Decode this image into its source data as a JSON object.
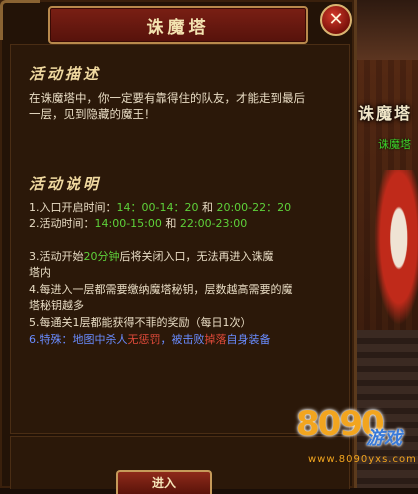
{
  "window": {
    "title": "诛魔塔",
    "close_label": "✕"
  },
  "section_description": {
    "title": "活动描述",
    "line1": "在诛魔塔中，你一定要有靠得住的队友，才能走到最后",
    "line2": "一层，见到隐藏的魔王！"
  },
  "section_rules": {
    "title": "活动说明",
    "rule1": {
      "prefix": "1.入口开启时间：",
      "time1": "14：00-14：20",
      "mid": " 和 ",
      "time2": "20:00-22：20"
    },
    "rule2": {
      "prefix": "2.活动时间：",
      "time1": "14:00-15:00",
      "mid": " 和 ",
      "time2": "22:00-23:00"
    },
    "rule3": {
      "prefix": "3.活动开始",
      "highlight": "20分钟",
      "suffix": "后将关闭入口，无法再进入诛魔",
      "cont": "塔内"
    },
    "rule4": {
      "line1": "4.每进入一层都需要缴纳魔塔秘钥，层数越高需要的魔",
      "line2": "塔秘钥越多"
    },
    "rule5": {
      "text": "5.每通关1层都能获得不菲的奖励（每日1次）"
    },
    "rule6": {
      "prefix": "6.特殊：地图中杀人",
      "red1": "无惩罚",
      "mid": "，被击败",
      "red2": "掉落",
      "suffix": "自身装备"
    }
  },
  "footer": {
    "enter_button": "进入"
  },
  "background": {
    "banner": "诛魔塔",
    "sub": "诛魔塔"
  },
  "watermark": {
    "number": "8090",
    "game": "游戏",
    "url": "www.8090yxs.com"
  }
}
